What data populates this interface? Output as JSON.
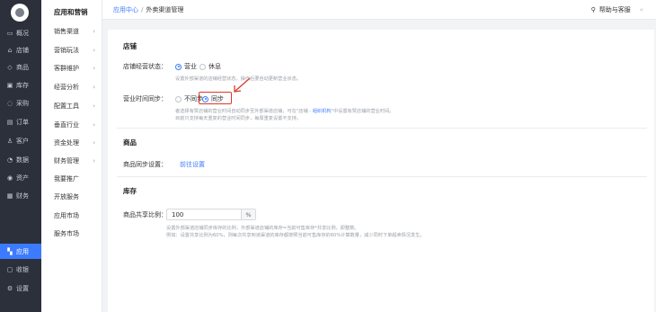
{
  "dark_sidebar": {
    "items": [
      {
        "label": "概况",
        "icon": "monitor-icon"
      },
      {
        "label": "店铺",
        "icon": "store-icon"
      },
      {
        "label": "商品",
        "icon": "tag-icon"
      },
      {
        "label": "库存",
        "icon": "box-icon"
      },
      {
        "label": "采购",
        "icon": "cart-icon"
      },
      {
        "label": "订单",
        "icon": "clipboard-icon"
      },
      {
        "label": "客户",
        "icon": "user-icon"
      },
      {
        "label": "数据",
        "icon": "chart-icon"
      },
      {
        "label": "资产",
        "icon": "asset-icon"
      },
      {
        "label": "财务",
        "icon": "finance-icon"
      },
      {
        "label": "应用",
        "icon": "grid-icon"
      },
      {
        "label": "收银",
        "icon": "cashier-icon"
      },
      {
        "label": "设置",
        "icon": "gear-icon"
      }
    ],
    "active": "应用"
  },
  "light_sidebar": {
    "title": "应用和营销",
    "items": [
      {
        "label": "销售渠道",
        "chevron": true
      },
      {
        "label": "营销玩法",
        "chevron": true
      },
      {
        "label": "客群维护",
        "chevron": true
      },
      {
        "label": "经营分析",
        "chevron": true
      },
      {
        "label": "配置工具",
        "chevron": true
      },
      {
        "label": "垂直行业",
        "chevron": true
      },
      {
        "label": "资金处理",
        "chevron": true
      },
      {
        "label": "财务管理",
        "chevron": true
      },
      {
        "label": "我要推广",
        "chevron": false
      },
      {
        "label": "开放服务",
        "chevron": false
      },
      {
        "label": "应用市场",
        "chevron": false
      },
      {
        "label": "服务市场",
        "chevron": false
      }
    ]
  },
  "topbar": {
    "crumb_link": "应用中心",
    "crumb_sep": "/",
    "crumb_current": "外卖渠道管理",
    "help": "帮助与客服",
    "collapse": "«"
  },
  "store_section": {
    "title": "店铺",
    "status_label": "店铺经营状态：",
    "status_options": [
      "营业",
      "休息"
    ],
    "status_selected": "营业",
    "status_hint": "设置外部渠道的店铺经营状态，操作后要自动更新营业状态。",
    "time_sync_label": "营业时间同步：",
    "time_sync_options": [
      "不同步",
      "同步"
    ],
    "time_sync_selected": "同步",
    "time_sync_hint_1_pre": "者选择有赞店铺的营业时间自动同步至外部渠道店铺，可在\"店铺 - ",
    "time_sync_hint_1_link": "组织机构",
    "time_sync_hint_1_post": "\"中设置有赞店铺的营业时间。",
    "time_sync_hint_2": "目前只支持每天重复的营业时间同步，每周重复设置不支持。"
  },
  "goods_section": {
    "title": "商品",
    "sync_label": "商品同步设置：",
    "sync_link": "前往设置"
  },
  "inventory_section": {
    "title": "库存",
    "share_label": "商品共享比例：",
    "share_value": "100",
    "share_unit": "%",
    "hint_1": "设置外部渠道店铺同步库存的比例，外部渠道店铺的库存=当前可售库存*共享比例，即整数。",
    "hint_2": "例如：设置共享比例为60%，则每次共享到该渠道的库存都按照当前可售库存的60%计算数量，减少同时下单超卖情况发生。"
  },
  "colors": {
    "sidebar_bg": "#2b303b",
    "accent": "#3c7bff",
    "highlight": "#d93a2b"
  }
}
